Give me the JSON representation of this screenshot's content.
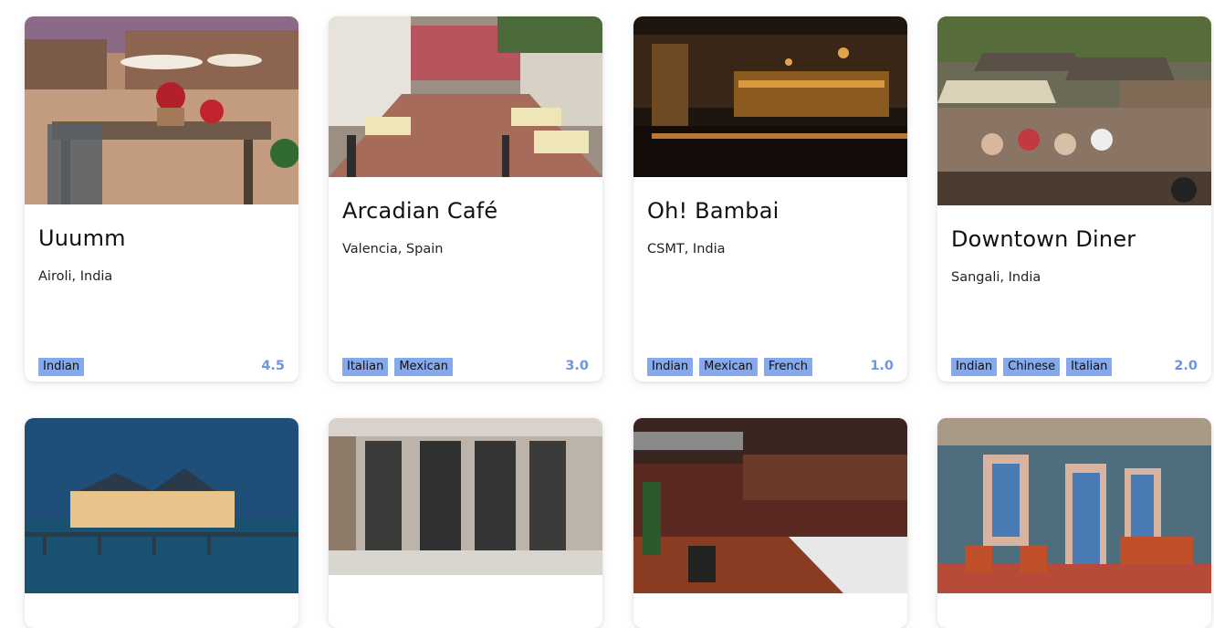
{
  "restaurants": [
    {
      "name": "Uuumm",
      "location": "Airoli, India",
      "cuisines": [
        "Indian"
      ],
      "rating": "4.5",
      "image": "outdoor-terrace-with-flowers-photo"
    },
    {
      "name": "Arcadian Café",
      "location": "Valencia, Spain",
      "cuisines": [
        "Italian",
        "Mexican"
      ],
      "rating": "3.0",
      "image": "courtyard-cafe-photo"
    },
    {
      "name": "Oh! Bambai",
      "location": "CSMT, India",
      "cuisines": [
        "Indian",
        "Mexican",
        "French"
      ],
      "rating": "1.0",
      "image": "dark-bar-interior-photo"
    },
    {
      "name": "Downtown Diner",
      "location": "Sangali, India",
      "cuisines": [
        "Indian",
        "Chinese",
        "Italian"
      ],
      "rating": "2.0",
      "image": "street-cafe-with-awnings-photo"
    },
    {
      "image": "pier-at-dusk-photo"
    },
    {
      "image": "stone-arched-storefront-photo"
    },
    {
      "image": "industrial-restaurant-interior-photo"
    },
    {
      "image": "colorful-facade-with-chairs-photo"
    }
  ]
}
